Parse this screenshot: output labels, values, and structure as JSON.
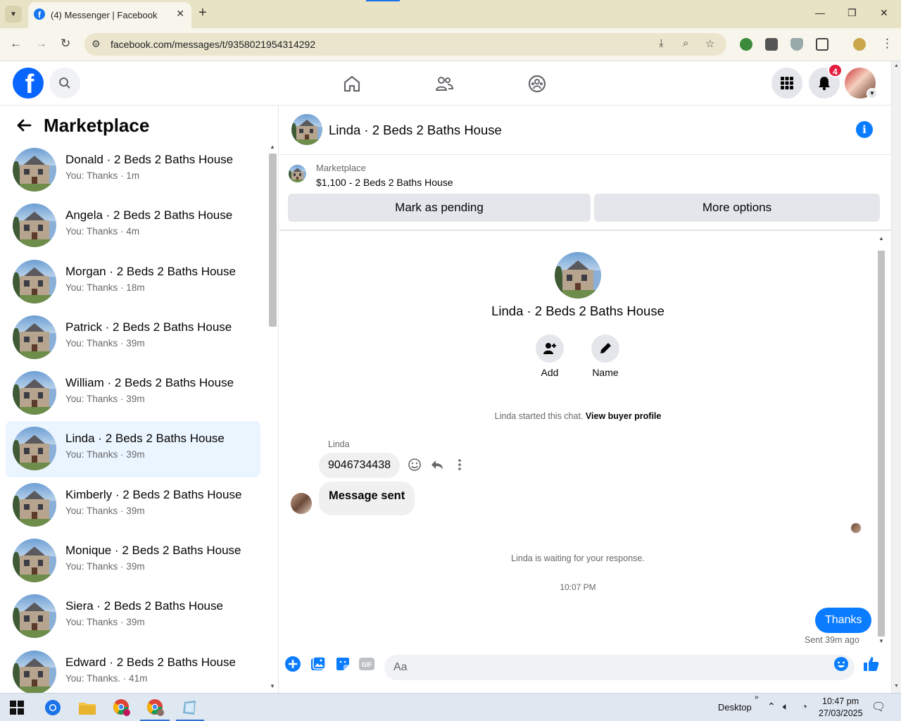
{
  "browser": {
    "tab_title": "(4) Messenger | Facebook",
    "url": "facebook.com/messages/t/9358021954314292"
  },
  "fb_header": {
    "notification_count": "4"
  },
  "sidebar": {
    "title": "Marketplace",
    "conversations": [
      {
        "name": "Donald · 2 Beds 2 Baths House",
        "preview": "You: Thanks · 1m",
        "active": false
      },
      {
        "name": "Angela · 2 Beds 2 Baths House",
        "preview": "You: Thanks · 4m",
        "active": false
      },
      {
        "name": "Morgan · 2 Beds 2 Baths House",
        "preview": "You: Thanks · 18m",
        "active": false
      },
      {
        "name": "Patrick · 2 Beds 2 Baths House",
        "preview": "You: Thanks · 39m",
        "active": false
      },
      {
        "name": "William · 2 Beds 2 Baths House",
        "preview": "You: Thanks · 39m",
        "active": false
      },
      {
        "name": "Linda · 2 Beds 2 Baths House",
        "preview": "You: Thanks · 39m",
        "active": true
      },
      {
        "name": "Kimberly · 2 Beds 2 Baths House",
        "preview": "You: Thanks · 39m",
        "active": false
      },
      {
        "name": "Monique · 2 Beds 2 Baths House",
        "preview": "You: Thanks · 39m",
        "active": false
      },
      {
        "name": "Siera · 2 Beds 2 Baths House",
        "preview": "You: Thanks · 39m",
        "active": false
      },
      {
        "name": "Edward · 2 Beds 2 Baths House",
        "preview": "You: Thanks. · 41m",
        "active": false
      }
    ]
  },
  "chat": {
    "header_title": "Linda · 2 Beds 2 Baths House",
    "marketplace_label": "Marketplace",
    "listing": "$1,100 - 2 Beds 2 Baths House",
    "mark_pending_label": "Mark as pending",
    "more_options_label": "More options",
    "profile_title": "Linda · 2 Beds 2 Baths House",
    "add_label": "Add",
    "name_label": "Name",
    "started_text": "Linda started this chat.",
    "view_profile_link": "View buyer profile",
    "sender_name": "Linda",
    "message_1": "9046734438",
    "message_2": "Message sent",
    "waiting_text": "Linda is waiting for your response.",
    "timestamp": "10:07 PM",
    "outgoing_message": "Thanks",
    "sent_status": "Sent 39m ago",
    "composer_placeholder": "Aa"
  },
  "taskbar": {
    "desktop_label": "Desktop",
    "time": "10:47 pm",
    "date": "27/03/2025"
  },
  "colors": {
    "fb_blue": "#0866ff",
    "messenger_blue": "#0a7cff",
    "badge_red": "#e41e3f",
    "active_row": "#ebf5ff"
  }
}
